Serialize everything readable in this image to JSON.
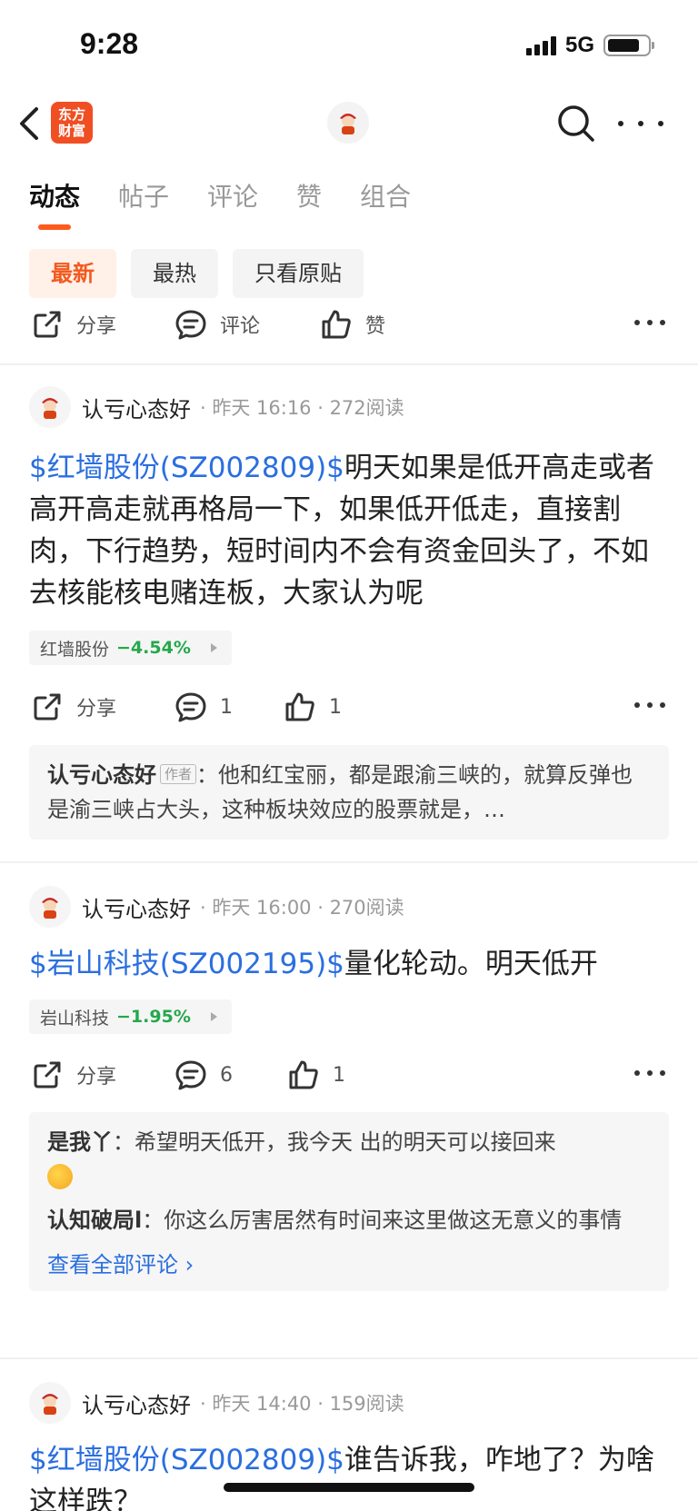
{
  "status": {
    "time": "9:28",
    "network": "5G"
  },
  "nav": {
    "logo_line1": "东方",
    "logo_line2": "财富"
  },
  "tabs": [
    "动态",
    "帖子",
    "评论",
    "赞",
    "组合"
  ],
  "filters": [
    "最新",
    "最热",
    "只看原贴"
  ],
  "top_actions": {
    "share": "分享",
    "comment": "评论",
    "like": "赞"
  },
  "posts": [
    {
      "user": "认亏心态好",
      "meta": "· 昨天 16:16 · 272阅读",
      "stock_tag": "$红墙股份(SZ002809)$",
      "text": "明天如果是低开高走或者高开高走就再格局一下，如果低开低走，直接割肉，下行趋势，短时间内不会有资金回头了，不如去核能核电赌连板，大家认为呢",
      "chip_name": "红墙股份",
      "chip_pct": "−4.54%",
      "share": "分享",
      "comments": "1",
      "likes": "1",
      "reply": {
        "name": "认亏心态好",
        "tag": "作者",
        "text": "：他和红宝丽，都是跟渝三峡的，就算反弹也是渝三峡占大头，这种板块效应的股票就是，…"
      }
    },
    {
      "user": "认亏心态好",
      "meta": "· 昨天 16:00 · 270阅读",
      "stock_tag": "$岩山科技(SZ002195)$",
      "text": "量化轮动。明天低开",
      "chip_name": "岩山科技",
      "chip_pct": "−1.95%",
      "share": "分享",
      "comments": "6",
      "likes": "1",
      "replies": [
        {
          "name": "是我丫",
          "text": "：希望明天低开，我今天 出的明天可以接回来"
        },
        {
          "name": "认知破局l",
          "text": "：你这么厉害居然有时间来这里做这无意义的事情"
        }
      ],
      "view_all": "查看全部评论 ›"
    },
    {
      "user": "认亏心态好",
      "meta": "· 昨天 14:40 · 159阅读",
      "stock_tag": "$红墙股份(SZ002809)$",
      "text": "谁告诉我，咋地了？为啥这样跌？"
    }
  ]
}
